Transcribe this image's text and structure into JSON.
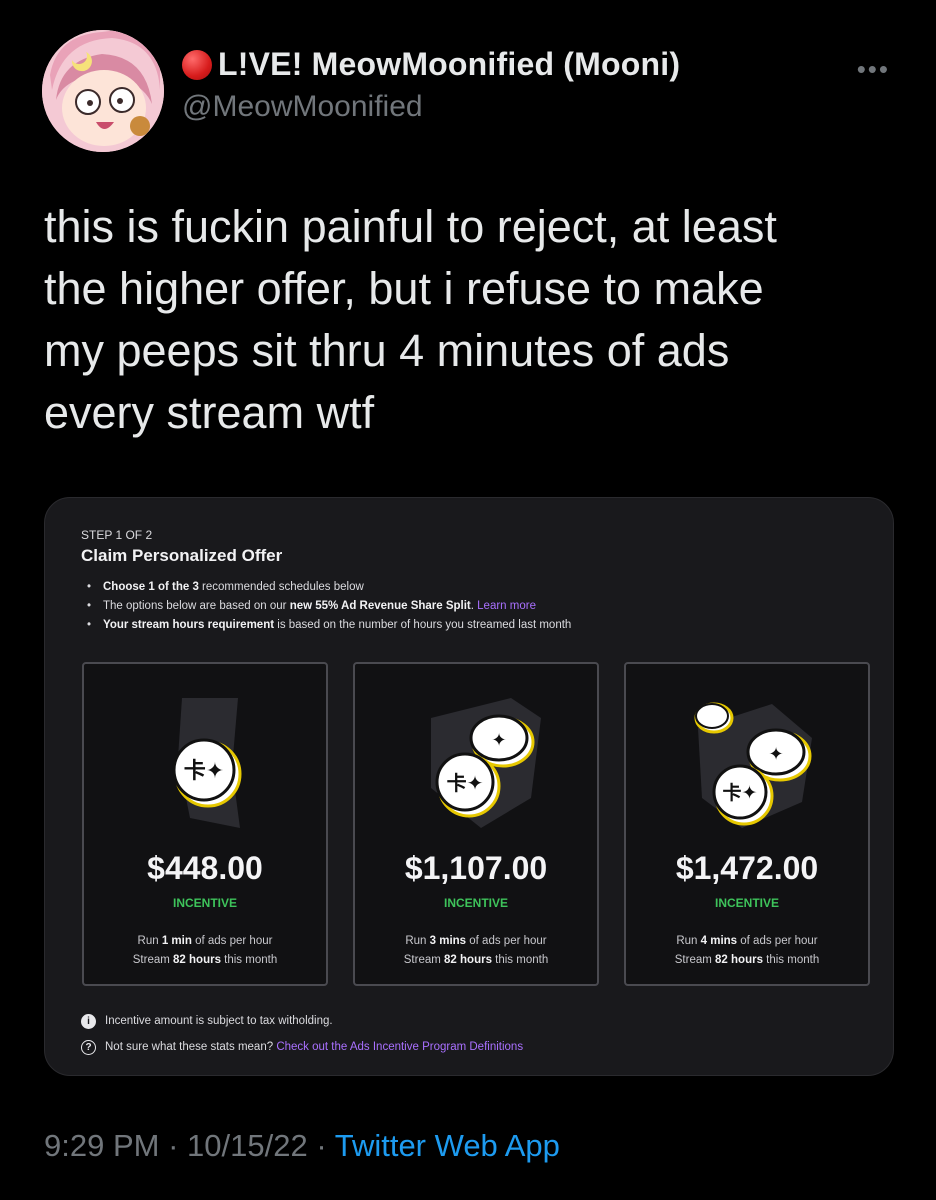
{
  "tweet": {
    "display_name": "L!VE! MeowMoonified (Mooni)",
    "handle": "@MeowMoonified",
    "text": "this is fuckin painful to reject, at least\nthe higher offer, but i refuse to make\nmy peeps sit thru 4 minutes of ads\nevery stream wtf",
    "time": "9:29 PM",
    "date": "10/15/22",
    "source": "Twitter Web App",
    "sep": "·",
    "icons": {
      "live": "red-circle-icon",
      "more": "more-horizontal-icon"
    }
  },
  "offer_card": {
    "step": "STEP 1 OF 2",
    "title": "Claim Personalized Offer",
    "bullets": {
      "b1_bold": "Choose 1 of the 3",
      "b1_rest": " recommended schedules below",
      "b2_pre": "The options below are based on our ",
      "b2_bold": "new 55% Ad Revenue Share Split",
      "b2_post": ". ",
      "b2_link": "Learn more",
      "b3_bold": "Your stream hours requirement",
      "b3_rest": " is based on the number of hours you streamed last month"
    },
    "offers": [
      {
        "price": "$448.00",
        "label": "INCENTIVE",
        "run_pre": "Run ",
        "run_bold": "1 min",
        "run_post": " of ads per hour",
        "stream_pre": "Stream ",
        "stream_bold": "82 hours",
        "stream_post": " this month"
      },
      {
        "price": "$1,107.00",
        "label": "INCENTIVE",
        "run_pre": "Run ",
        "run_bold": "3 mins",
        "run_post": " of ads per hour",
        "stream_pre": "Stream ",
        "stream_bold": "82 hours",
        "stream_post": " this month"
      },
      {
        "price": "$1,472.00",
        "label": "INCENTIVE",
        "run_pre": "Run ",
        "run_bold": "4 mins",
        "run_post": " of ads per hour",
        "stream_pre": "Stream ",
        "stream_bold": "82 hours",
        "stream_post": " this month"
      }
    ],
    "notes": {
      "tax": "Incentive amount is subject to tax witholding.",
      "help_pre": "Not sure what these stats mean? ",
      "help_link": "Check out the Ads Incentive Program Definitions"
    },
    "colors": {
      "accent": "#a970ff",
      "incentive": "#3ec35b",
      "twitter_blue": "#1d9bf0"
    }
  }
}
